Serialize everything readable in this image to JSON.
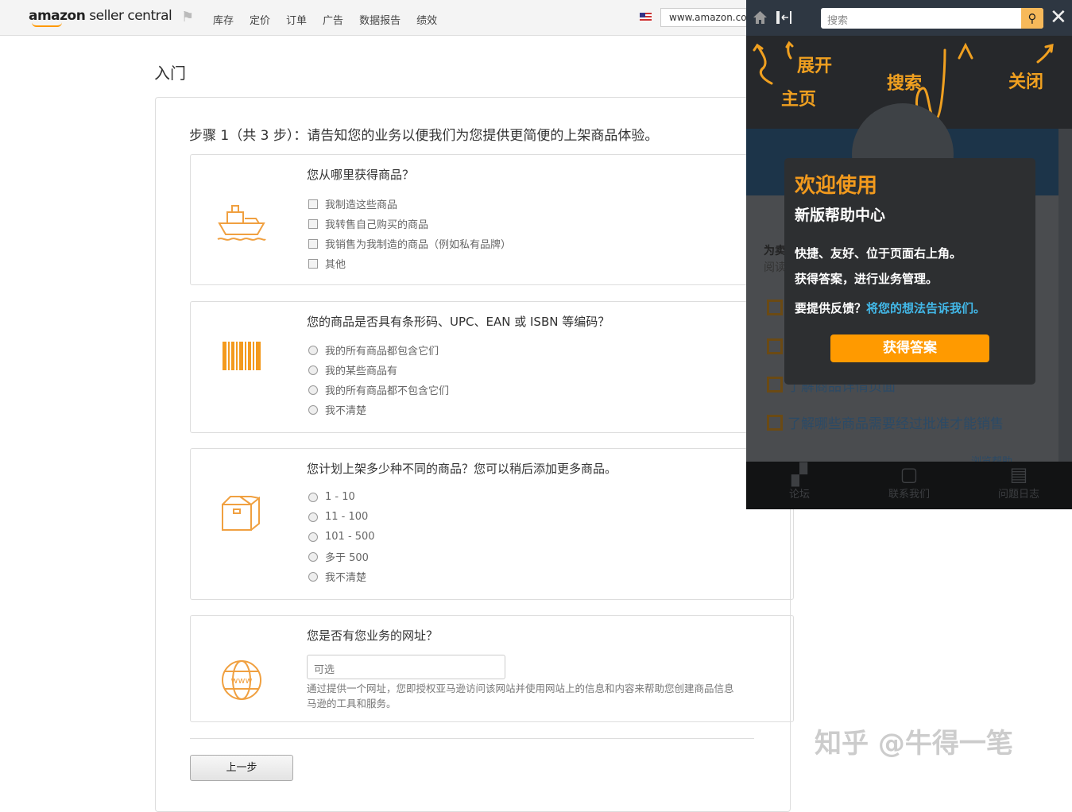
{
  "header": {
    "logo_brand": "amazon",
    "logo_rest": "seller central",
    "nav": [
      "库存",
      "定价",
      "订单",
      "广告",
      "数据报告",
      "绩效"
    ],
    "marketplace": "www.amazon.com"
  },
  "page": {
    "title": "入门",
    "step": "步骤 1（共 3 步）：请告知您的业务以便我们为您提供更简便的上架商品体验。"
  },
  "q1": {
    "question": "您从哪里获得商品？",
    "options": [
      "我制造这些商品",
      "我转售自己购买的商品",
      "我销售为我制造的商品（例如私有品牌）",
      "其他"
    ]
  },
  "q2": {
    "question": "您的商品是否具有条形码、UPC、EAN 或 ISBN 等编码？",
    "options": [
      "我的所有商品都包含它们",
      "我的某些商品有",
      "我的所有商品都不包含它们",
      "我不清楚"
    ]
  },
  "q3": {
    "question": "您计划上架多少种不同的商品？您可以稍后添加更多商品。",
    "options": [
      "1 - 10",
      "11 - 100",
      "101 - 500",
      "多于 500",
      "我不清楚"
    ]
  },
  "q4": {
    "question": "您是否有您业务的网址？",
    "placeholder": "可选",
    "help1": "通过提供一个网址，您即授权亚马逊访问该网站并使用网站上的信息和内容来帮助您创建商品信息",
    "help2": "马逊的工具和服务。"
  },
  "back_label": "上一步",
  "watermark": "知乎 @牛得一笔",
  "panel": {
    "search_placeholder": "搜索",
    "annotations": {
      "home": "主页",
      "expand": "展开",
      "search": "搜索",
      "close": "关闭"
    },
    "bg_heading": "为卖",
    "bg_sub": "阅读",
    "bg_links": [
      "了解商品详情页面",
      "了解哪些商品需要经过批准才能销售"
    ],
    "bg_more": "浏览帮助",
    "footer": [
      "论坛",
      "联系我们",
      "问题日志"
    ],
    "modal": {
      "title": "欢迎使用",
      "subtitle": "新版帮助中心",
      "line1": "快捷、友好、位于页面右上角。",
      "line2": "获得答案，进行业务管理。",
      "feedback": "要提供反馈？",
      "feedback_link": "将您的想法告诉我们。",
      "button": "获得答案"
    }
  }
}
